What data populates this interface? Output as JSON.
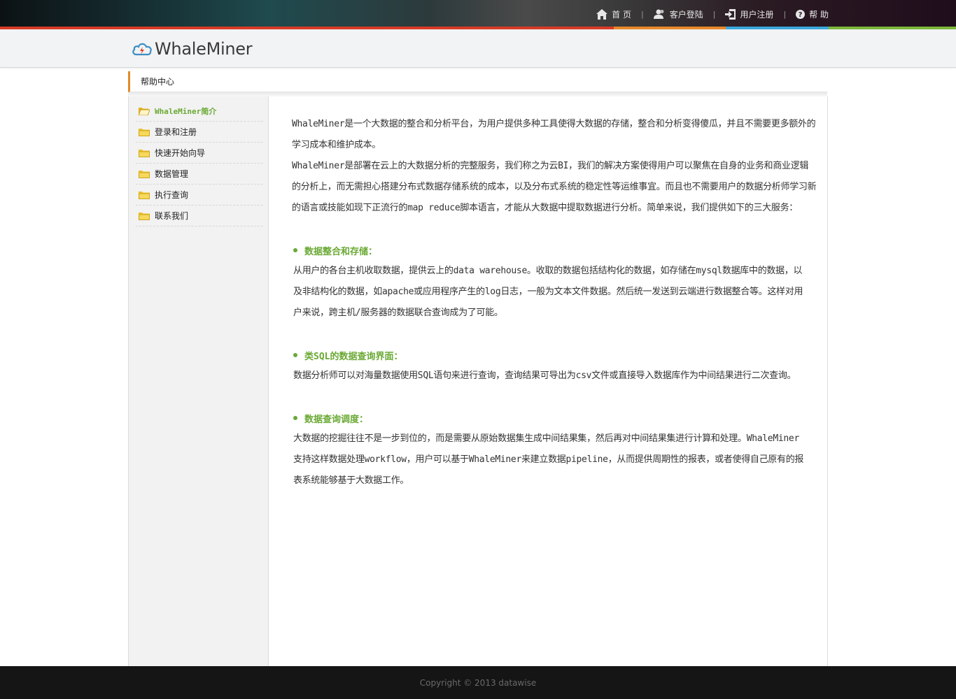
{
  "topnav": {
    "home": "首 页",
    "login": "客户登陆",
    "register": "用户注册",
    "help": "帮 助",
    "separator": "|"
  },
  "brand": {
    "name": "WhaleMiner"
  },
  "breadcrumb": {
    "label": "帮助中心"
  },
  "sidebar": {
    "items": [
      {
        "label": "WhaleMiner简介",
        "active": true
      },
      {
        "label": "登录和注册"
      },
      {
        "label": "快速开始向导"
      },
      {
        "label": "数据管理"
      },
      {
        "label": "执行查询"
      },
      {
        "label": "联系我们"
      }
    ]
  },
  "content": {
    "intro1": "WhaleMiner是一个大数据的整合和分析平台，为用户提供多种工具使得大数据的存储，整合和分析变得傻瓜，并且不需要更多额外的学习成本和维护成本。",
    "intro2": "WhaleMiner是部署在云上的大数据分析的完整服务，我们称之为云BI，我们的解决方案使得用户可以聚焦在自身的业务和商业逻辑的分析上，而无需担心搭建分布式数据存储系统的成本，以及分布式系统的稳定性等运维事宜。而且也不需要用户的数据分析师学习新的语言或技能如现下正流行的map reduce脚本语言，才能从大数据中提取数据进行分析。简单来说，我们提供如下的三大服务：",
    "sections": [
      {
        "title": "数据整合和存储：",
        "body": "从用户的各台主机收取数据，提供云上的data warehouse。收取的数据包括结构化的数据，如存储在mysql数据库中的数据，以及非结构化的数据，如apache或应用程序产生的log日志，一般为文本文件数据。然后统一发送到云端进行数据整合等。这样对用户来说，跨主机/服务器的数据联合查询成为了可能。"
      },
      {
        "title": "类SQL的数据查询界面：",
        "body": "数据分析师可以对海量数据使用SQL语句来进行查询，查询结果可导出为csv文件或直接导入数据库作为中间结果进行二次查询。"
      },
      {
        "title": "数据查询调度：",
        "body": "大数据的挖掘往往不是一步到位的，而是需要从原始数据集生成中间结果集，然后再对中间结果集进行计算和处理。WhaleMiner支持这样数据处理workflow，用户可以基于WhaleMiner来建立数据pipeline，从而提供周期性的报表，或者使得自己原有的报表系统能够基于大数据工作。"
      }
    ]
  },
  "footer": {
    "copyright": "Copyright © 2013 datawise"
  },
  "colors": {
    "accent_green": "#6aa934",
    "breadcrumb_orange": "#e28a2b",
    "stripe_red": "#d83b26",
    "stripe_blue": "#3aa7dc"
  }
}
